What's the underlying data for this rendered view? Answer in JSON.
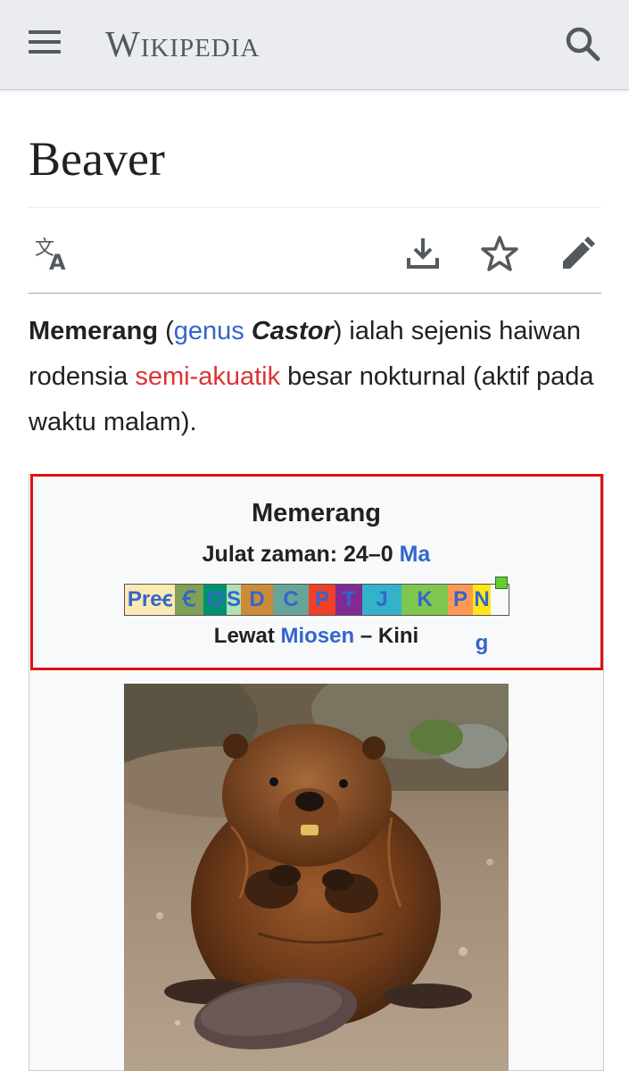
{
  "header": {
    "logo_text": "Wikipedia",
    "menu_icon": "hamburger-menu-icon",
    "search_icon": "search-icon",
    "background": "#eaecf0"
  },
  "page": {
    "title": "Beaver",
    "actions": [
      {
        "name": "language",
        "icon": "translate-icon"
      },
      {
        "name": "download",
        "icon": "download-icon"
      },
      {
        "name": "watch",
        "icon": "star-icon"
      },
      {
        "name": "edit",
        "icon": "pencil-icon"
      }
    ]
  },
  "lead": {
    "bold_term": "Memerang",
    "open_paren": " (",
    "genus_link": "genus",
    "genus_name": " Castor",
    "after_genus": ") ialah sejenis haiwan rodensia ",
    "semi_link": "semi-akuatik",
    "rest": " besar nokturnal (aktif pada waktu malam).",
    "link_color": "#3366cc",
    "redlink_color": "#dd3333"
  },
  "infobox": {
    "title": "Memerang",
    "range_label": "Julat zaman: 24–0 ",
    "range_link": "Ma",
    "timescale": [
      {
        "label": "Preꞓ",
        "color": "#fde9b4"
      },
      {
        "label": "Ꞓ",
        "color": "#7fa056"
      },
      {
        "label": "O",
        "color": "#009270"
      },
      {
        "label": "S",
        "color": "#b3e1b6"
      },
      {
        "label": "D",
        "color": "#cb8c37"
      },
      {
        "label": "C",
        "color": "#67a599"
      },
      {
        "label": "P",
        "color": "#f04028"
      },
      {
        "label": "T",
        "color": "#812b92"
      },
      {
        "label": "J",
        "color": "#34b2c9"
      },
      {
        "label": "K",
        "color": "#7fc64e"
      },
      {
        "label": "P",
        "color": "#fd9a52"
      },
      {
        "label": "N",
        "color": "#ffe619"
      }
    ],
    "sub_prefix": "Lewat ",
    "sub_link": "Miosen",
    "sub_suffix": " – Kini",
    "ng_label": "g",
    "highlight_color": "#dd1111",
    "image_alt": "Memerang (beaver) duduk di atas tanah"
  }
}
